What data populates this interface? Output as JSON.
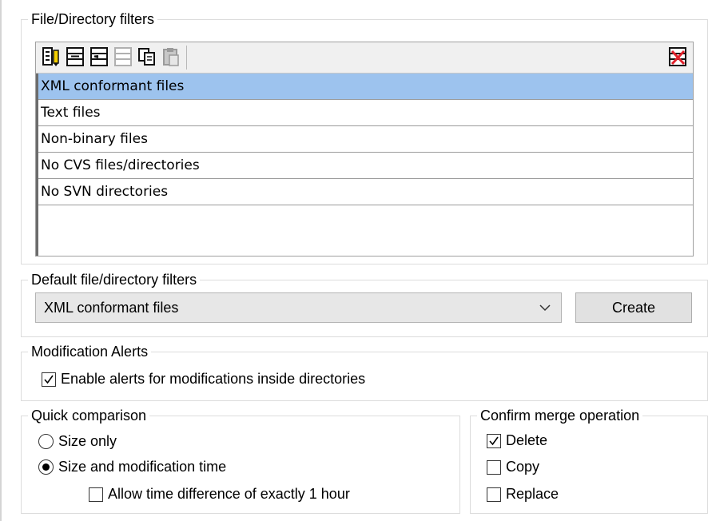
{
  "file_filters": {
    "group_title": "File/Directory filters",
    "toolbar": [
      "add-filter-icon",
      "insert-filter-icon",
      "append-filter-icon",
      "move-filter-icon",
      "copy-filter-icon",
      "paste-filter-icon",
      "delete-filter-icon"
    ],
    "items": [
      "XML conformant files",
      "Text files",
      "Non-binary files",
      "No CVS files/directories",
      "No SVN directories"
    ],
    "selected_index": 0
  },
  "default_filters": {
    "group_title": "Default file/directory filters",
    "selected_value": "XML conformant files",
    "create_label": "Create"
  },
  "modification_alerts": {
    "group_title": "Modification Alerts",
    "enable_label": "Enable alerts for modifications inside directories",
    "enable_checked": true
  },
  "quick_comparison": {
    "group_title": "Quick comparison",
    "size_only_label": "Size only",
    "size_and_time_label": "Size and modification time",
    "selected": "size_and_time",
    "allow_time_diff_label": "Allow time difference of exactly 1 hour",
    "allow_time_diff_checked": false
  },
  "confirm_merge": {
    "group_title": "Confirm merge operation",
    "delete_label": "Delete",
    "delete_checked": true,
    "copy_label": "Copy",
    "copy_checked": false,
    "replace_label": "Replace",
    "replace_checked": false
  },
  "colors": {
    "selection": "#9dc3ee",
    "group_border": "#dcdcdc",
    "toolbar_icon_dark": "#111111",
    "toolbar_icon_disabled": "#b0b0b0",
    "delete_accent": "#e0202a"
  }
}
